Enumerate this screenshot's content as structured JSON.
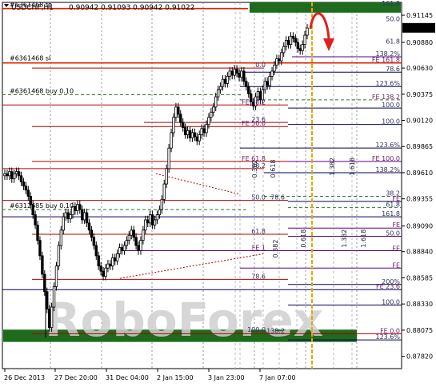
{
  "header": {
    "symbol": "USDCHF,H1",
    "quote": "0.90942 0.91093 0.90942 0.91022"
  },
  "colors": {
    "up_candle": "#000000",
    "down_candle": "#000000",
    "fib_red": "#b40000",
    "fib_purple": "#5a0080",
    "fib_navy": "#00005a",
    "fe_green": "#2f7a2f",
    "order_line": "#dd2200",
    "time_line": "#e6a800",
    "target_box": "#1e6b1e",
    "arrow": "#e02020",
    "watermark": "#cfcfcf"
  },
  "order_labels": [
    {
      "text": "#6361468 tp",
      "price": 0.9121
    },
    {
      "text": "#6361468 sl",
      "price": 0.9069
    },
    {
      "text": "#6361468 buy 0.10",
      "price": 0.9037
    },
    {
      "text": "#6312685 buy 0.10",
      "price": 0.8925
    }
  ],
  "current_price": "0.91022",
  "watermark": "RoboForex",
  "level_labels": [
    {
      "text": "161.8",
      "price": 0.9123,
      "side": "right"
    },
    {
      "text": "50.0",
      "price": 0.9108,
      "side": "right"
    },
    {
      "text": "61.8",
      "price": 0.9086,
      "side": "right"
    },
    {
      "text": "138.2%",
      "price": 0.9074,
      "side": "right"
    },
    {
      "text": "FE 161.8",
      "price": 0.9068,
      "side": "right"
    },
    {
      "text": "0.0",
      "price": 0.9063,
      "side": "mid"
    },
    {
      "text": "78.6",
      "price": 0.9059,
      "side": "right"
    },
    {
      "text": "123.6%",
      "price": 0.9045,
      "side": "right"
    },
    {
      "text": "FE 138.2",
      "price": 0.9032,
      "side": "right"
    },
    {
      "text": "FE 38.2",
      "price": 0.9027,
      "side": "mid"
    },
    {
      "text": "100.0",
      "price": 0.9024,
      "side": "right"
    },
    {
      "text": "23.6",
      "price": 0.901,
      "side": "mid"
    },
    {
      "text": "FE 50.0",
      "price": 0.9006,
      "side": "mid"
    },
    {
      "text": "100.0",
      "price": 0.9008,
      "side": "right"
    },
    {
      "text": "123.6%",
      "price": 0.8985,
      "side": "right"
    },
    {
      "text": "FE 61.8",
      "price": 0.8972,
      "side": "mid"
    },
    {
      "text": "FE 100.0",
      "price": 0.8972,
      "side": "right"
    },
    {
      "text": "38.2",
      "price": 0.8965,
      "side": "mid"
    },
    {
      "text": "138.2%",
      "price": 0.8961,
      "side": "right"
    },
    {
      "text": "50.0",
      "price": 0.8934,
      "side": "mid"
    },
    {
      "text": "78.6",
      "price": 0.8934,
      "side": "mid2"
    },
    {
      "text": "38.2",
      "price": 0.8938,
      "side": "right"
    },
    {
      "text": "FE",
      "price": 0.8933,
      "side": "right"
    },
    {
      "text": "61.8",
      "price": 0.8927,
      "side": "right"
    },
    {
      "text": "161.8",
      "price": 0.8918,
      "side": "right"
    },
    {
      "text": "FE",
      "price": 0.8907,
      "side": "right"
    },
    {
      "text": "61.8",
      "price": 0.8901,
      "side": "mid"
    },
    {
      "text": "50.0",
      "price": 0.8899,
      "side": "right"
    },
    {
      "text": "FE",
      "price": 0.8884,
      "side": "right"
    },
    {
      "text": "FE 1",
      "price": 0.8885,
      "side": "mid"
    },
    {
      "text": "FE",
      "price": 0.8868,
      "side": "right"
    },
    {
      "text": "78.6",
      "price": 0.8857,
      "side": "mid"
    },
    {
      "text": "200%",
      "price": 0.8852,
      "side": "right"
    },
    {
      "text": "FE 23.6",
      "price": 0.8847,
      "side": "right"
    },
    {
      "text": "100.0",
      "price": 0.8832,
      "side": "right"
    },
    {
      "text": "100.0",
      "price": 0.8805,
      "side": "mid"
    },
    {
      "text": "138.2",
      "price": 0.8804,
      "side": "mid2"
    },
    {
      "text": "FE 0.0",
      "price": 0.8804,
      "side": "right"
    },
    {
      "text": "123.6%",
      "price": 0.8798,
      "side": "right"
    }
  ],
  "rotated_labels": [
    {
      "text": "0.382",
      "x_slot": 321,
      "price": 0.8956
    },
    {
      "text": "0.618",
      "x_slot": 344,
      "price": 0.8956
    },
    {
      "text": "0.382",
      "x_slot": 347,
      "price": 0.8878
    },
    {
      "text": "0.618",
      "x_slot": 382,
      "price": 0.8888
    },
    {
      "text": "1.382",
      "x_slot": 418,
      "price": 0.8958
    },
    {
      "text": "1.618",
      "x_slot": 443,
      "price": 0.8958
    },
    {
      "text": "1.382",
      "x_slot": 433,
      "price": 0.8888
    },
    {
      "text": "1.618",
      "x_slot": 457,
      "price": 0.8888
    }
  ],
  "chart_data": {
    "type": "candlestick",
    "title": "USDCHF,H1",
    "xlabel": "",
    "ylabel": "",
    "ylim": [
      0.877,
      0.9127
    ],
    "grid": true,
    "y_ticks": [
      0.91145,
      0.9088,
      0.9063,
      0.90375,
      0.9012,
      0.89865,
      0.8961,
      0.89355,
      0.8909,
      0.8884,
      0.88585,
      0.8833,
      0.88075,
      0.8782
    ],
    "x_ticks": [
      "26 Dec 2013",
      "27 Dec 20:00",
      "31 Dec 04:00",
      "2 Jan 15:00",
      "3 Jan 23:00",
      "7 Jan 07:00"
    ],
    "close_path": [
      0.896,
      0.8958,
      0.8962,
      0.8955,
      0.896,
      0.8962,
      0.8958,
      0.8952,
      0.8948,
      0.8944,
      0.8938,
      0.893,
      0.892,
      0.891,
      0.8895,
      0.888,
      0.8862,
      0.8845,
      0.8828,
      0.881,
      0.883,
      0.885,
      0.887,
      0.889,
      0.8905,
      0.8918,
      0.8922,
      0.8916,
      0.892,
      0.8928,
      0.8924,
      0.893,
      0.8925,
      0.8915,
      0.8922,
      0.8912,
      0.8905,
      0.8898,
      0.889,
      0.888,
      0.887,
      0.8865,
      0.886,
      0.8868,
      0.8872,
      0.887,
      0.8878,
      0.8875,
      0.8882,
      0.8888,
      0.8885,
      0.889,
      0.8895,
      0.89,
      0.8905,
      0.8898,
      0.889,
      0.8885,
      0.8895,
      0.8905,
      0.8915,
      0.8912,
      0.892,
      0.891,
      0.8915,
      0.892,
      0.8925,
      0.8935,
      0.895,
      0.8965,
      0.8985,
      0.9,
      0.9015,
      0.9025,
      0.9018,
      0.901,
      0.9005,
      0.8998,
      0.9002,
      0.8995,
      0.9,
      0.8996,
      0.8992,
      0.8998,
      0.9004,
      0.9,
      0.9008,
      0.9015,
      0.902,
      0.9025,
      0.9035,
      0.9042,
      0.9045,
      0.9052,
      0.9048,
      0.9055,
      0.906,
      0.9056,
      0.9062,
      0.9058,
      0.9054,
      0.906,
      0.905,
      0.9045,
      0.9038,
      0.903,
      0.9026,
      0.9035,
      0.904,
      0.9032,
      0.9042,
      0.905,
      0.9046,
      0.9055,
      0.906,
      0.9066,
      0.9072,
      0.907,
      0.9078,
      0.9084,
      0.909,
      0.9086,
      0.9094,
      0.9092,
      0.9088,
      0.9082,
      0.908,
      0.9086,
      0.9095,
      0.9102
    ],
    "target_zone_top": [
      0.9127,
      0.9117
    ],
    "target_zone_bottom": [
      0.8808,
      0.8796
    ],
    "series": []
  }
}
